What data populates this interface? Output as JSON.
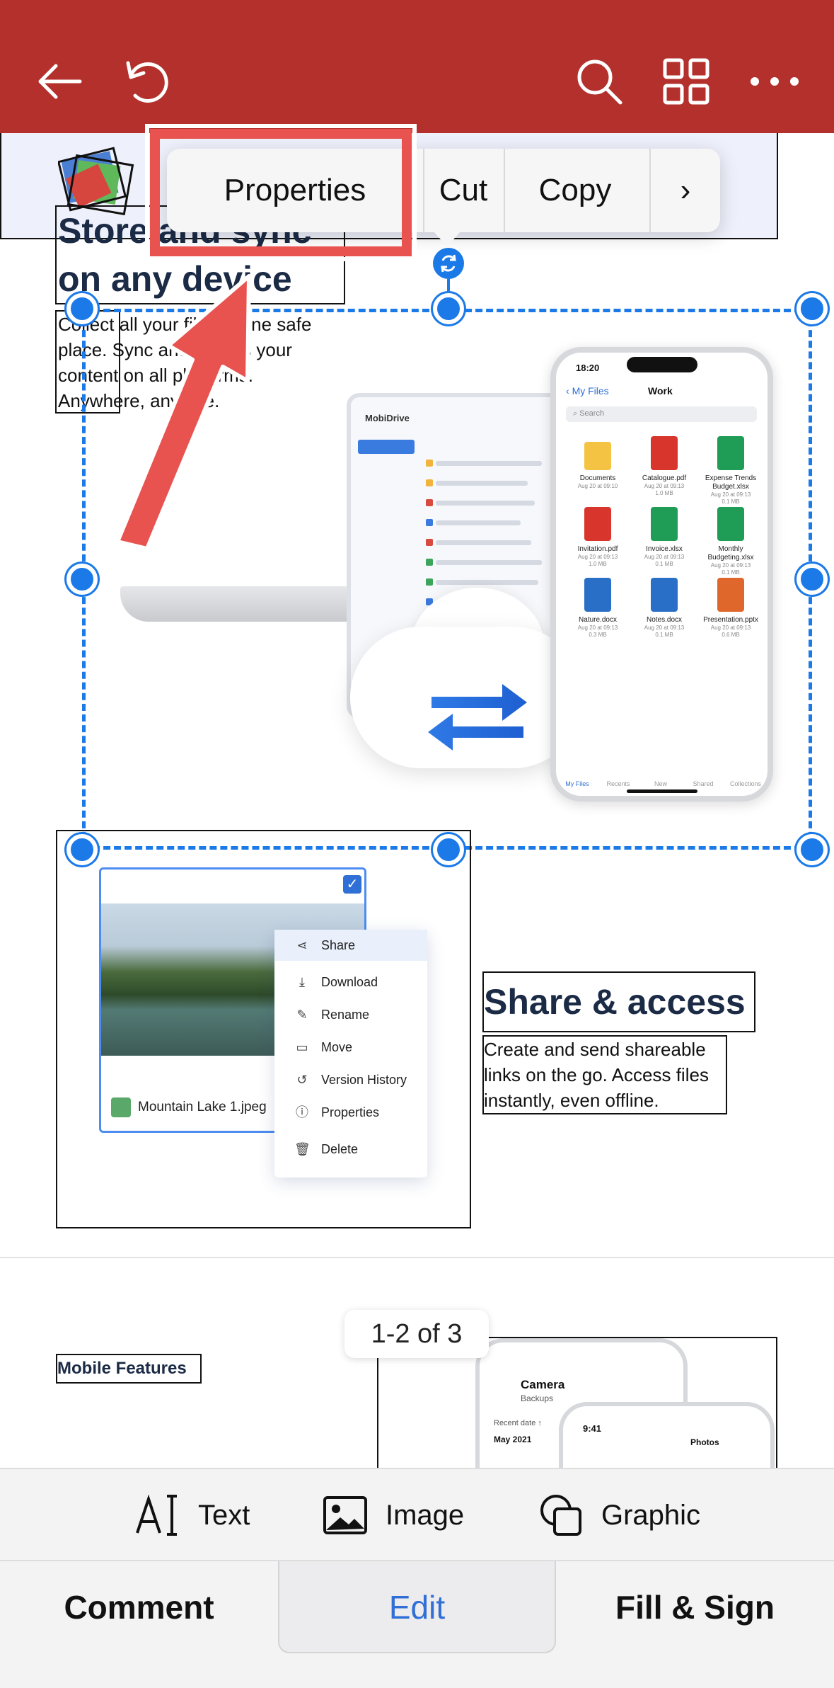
{
  "toolbar": {
    "back": "back-icon",
    "undo": "undo-icon",
    "search": "search-icon",
    "grid": "grid-icon",
    "more": "more-icon",
    "color": "#b3302c"
  },
  "context_menu": {
    "items": [
      "Properties",
      "Cut",
      "Copy"
    ],
    "more": "chevron-right-icon",
    "highlight_color": "#e8524f"
  },
  "hero": {
    "title_line1": "Store and sync",
    "title_line2": "on any device",
    "text": "Collect all your files in one safe place. Sync and access your content on all platforms. Anywhere, anytime."
  },
  "laptop": {
    "brand": "MobiDrive"
  },
  "phone": {
    "time": "18:20",
    "back": "My Files",
    "title": "Work",
    "search": "Search",
    "files": [
      {
        "name": "Documents",
        "meta": "Aug 20 at 09:10",
        "size": ""
      },
      {
        "name": "Catalogue.pdf",
        "meta": "Aug 20 at 09:13",
        "size": "1.0 MB"
      },
      {
        "name": "Expense Trends Budget.xlsx",
        "meta": "Aug 20 at 09:13",
        "size": "0.1 MB"
      },
      {
        "name": "Invitation.pdf",
        "meta": "Aug 20 at 09:13",
        "size": "1.0 MB"
      },
      {
        "name": "Invoice.xlsx",
        "meta": "Aug 20 at 09:13",
        "size": "0.1 MB"
      },
      {
        "name": "Monthly Budgeting.xlsx",
        "meta": "Aug 20 at 09:13",
        "size": "0.1 MB"
      },
      {
        "name": "Nature.docx",
        "meta": "Aug 20 at 09:13",
        "size": "0.3 MB"
      },
      {
        "name": "Notes.docx",
        "meta": "Aug 20 at 09:13",
        "size": "0.1 MB"
      },
      {
        "name": "Presentation.pptx",
        "meta": "Aug 20 at 09:13",
        "size": "0.6 MB"
      }
    ],
    "tabs": [
      "My Files",
      "Recents",
      "New",
      "Shared",
      "Collections"
    ]
  },
  "share": {
    "title": "Share & access",
    "text": "Create and send shareable links on the go. Access files instantly, even offline.",
    "file_name": "Mountain Lake 1.jpeg",
    "menu": [
      "Share",
      "Download",
      "Rename",
      "Move",
      "Version History",
      "Properties",
      "Delete"
    ]
  },
  "mobile": {
    "label": "Mobile Features",
    "camera_title": "Camera",
    "camera_sub": "Backups",
    "recent": "Recent date ↑",
    "month": "May 2021",
    "time2": "9:41",
    "photos": "Photos"
  },
  "page_indicator": "1-2 of 3",
  "tools": [
    "Text",
    "Image",
    "Graphic"
  ],
  "bottom_tabs": [
    "Comment",
    "Edit",
    "Fill & Sign"
  ],
  "accent": "#2f6fd6",
  "selection_color": "#1b7ae8"
}
